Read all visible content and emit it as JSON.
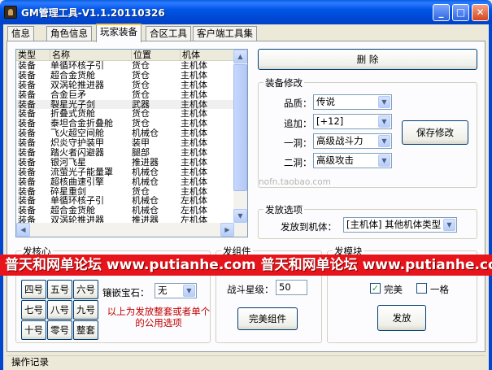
{
  "window": {
    "title": "GM管理工具-V1.1.20110326",
    "min_glyph": "_",
    "max_glyph": "□",
    "close_glyph": "✕"
  },
  "tabs": [
    {
      "label": "信息"
    },
    {
      "label": "角色信息"
    },
    {
      "label": "玩家装备"
    },
    {
      "label": "合区工具"
    },
    {
      "label": "客户端工具集"
    }
  ],
  "equipment_list": {
    "columns": [
      "类型",
      "名称",
      "位置",
      "机体"
    ],
    "rows": [
      [
        "装备",
        "单循环核子引",
        "货仓",
        "主机体"
      ],
      [
        "装备",
        "超合金货舱",
        "货仓",
        "主机体"
      ],
      [
        "装备",
        "双涡轮推进器",
        "货仓",
        "主机体"
      ],
      [
        "装备",
        "合金巨矛",
        "货仓",
        "主机体"
      ],
      [
        "装备",
        "裂星光子剑",
        "武器",
        "主机体"
      ],
      [
        "装备",
        "折叠式货舱",
        "货仓",
        "主机体"
      ],
      [
        "装备",
        "泰坦合金折叠舱",
        "货仓",
        "主机体"
      ],
      [
        "装备",
        "飞火超空间舱",
        "机械仓",
        "主机体"
      ],
      [
        "装备",
        "炽炎守护装甲",
        "装甲",
        "主机体"
      ],
      [
        "装备",
        "踏火者闪避器",
        "腿部",
        "主机体"
      ],
      [
        "装备",
        "银河飞星",
        "推进器",
        "主机体"
      ],
      [
        "装备",
        "流萤光子能量罩",
        "机械仓",
        "主机体"
      ],
      [
        "装备",
        "超核曲速引擎",
        "机械仓",
        "主机体"
      ],
      [
        "装备",
        "碎星重剑",
        "货仓",
        "主机体"
      ],
      [
        "装备",
        "单循环核子引",
        "机械仓",
        "左机体"
      ],
      [
        "装备",
        "超合金货舱",
        "机械仓",
        "左机体"
      ],
      [
        "装备",
        "双涡轮推进器",
        "推进器",
        "左机体"
      ]
    ],
    "selected_index": 4,
    "scroll_up": "▲",
    "scroll_down": "▼",
    "scroll_left": "◀",
    "scroll_right": "▶"
  },
  "delete_button": "删 除",
  "equip_modify": {
    "title": "装备修改",
    "fields": [
      {
        "label": "品质：",
        "value": "传说"
      },
      {
        "label": "追加：",
        "value": "[+12]"
      },
      {
        "label": "一洞：",
        "value": "高级战斗力"
      },
      {
        "label": "二洞：",
        "value": "高级攻击"
      }
    ],
    "save_button": "保存修改",
    "dropdown_glyph": "▼"
  },
  "send_options": {
    "title": "发放选项",
    "target_label": "发放到机体：",
    "target_value": "[主机体] 其他机体类型"
  },
  "watermark": "nofn.taobao.com",
  "core_group": {
    "title": "发核心",
    "gem_label": "镶嵌宝石：",
    "gem_value": "无",
    "numbers": [
      "四号",
      "五号",
      "六号",
      "七号",
      "八号",
      "九号",
      "十号",
      "零号",
      "整套"
    ],
    "note": "以上为发放整套或者单个的公用选项"
  },
  "component_group": {
    "title": "发组件",
    "star_label": "战斗星级：",
    "star_value": "50",
    "perfect_button": "完美组件"
  },
  "module_group": {
    "title": "发模块",
    "perfect_label": "完美",
    "perfect_checked": true,
    "grade_label": "一格",
    "grade_checked": false,
    "send_button": "发放"
  },
  "banner": "普天和网单论坛 www.putianhe.com  普天和网单论坛 www.putianhe.com",
  "op_log_title": "操作记录",
  "colors": {
    "banner_bg": "#e8141c",
    "title_bar": "#0055e5",
    "note_red": "#c00000"
  }
}
